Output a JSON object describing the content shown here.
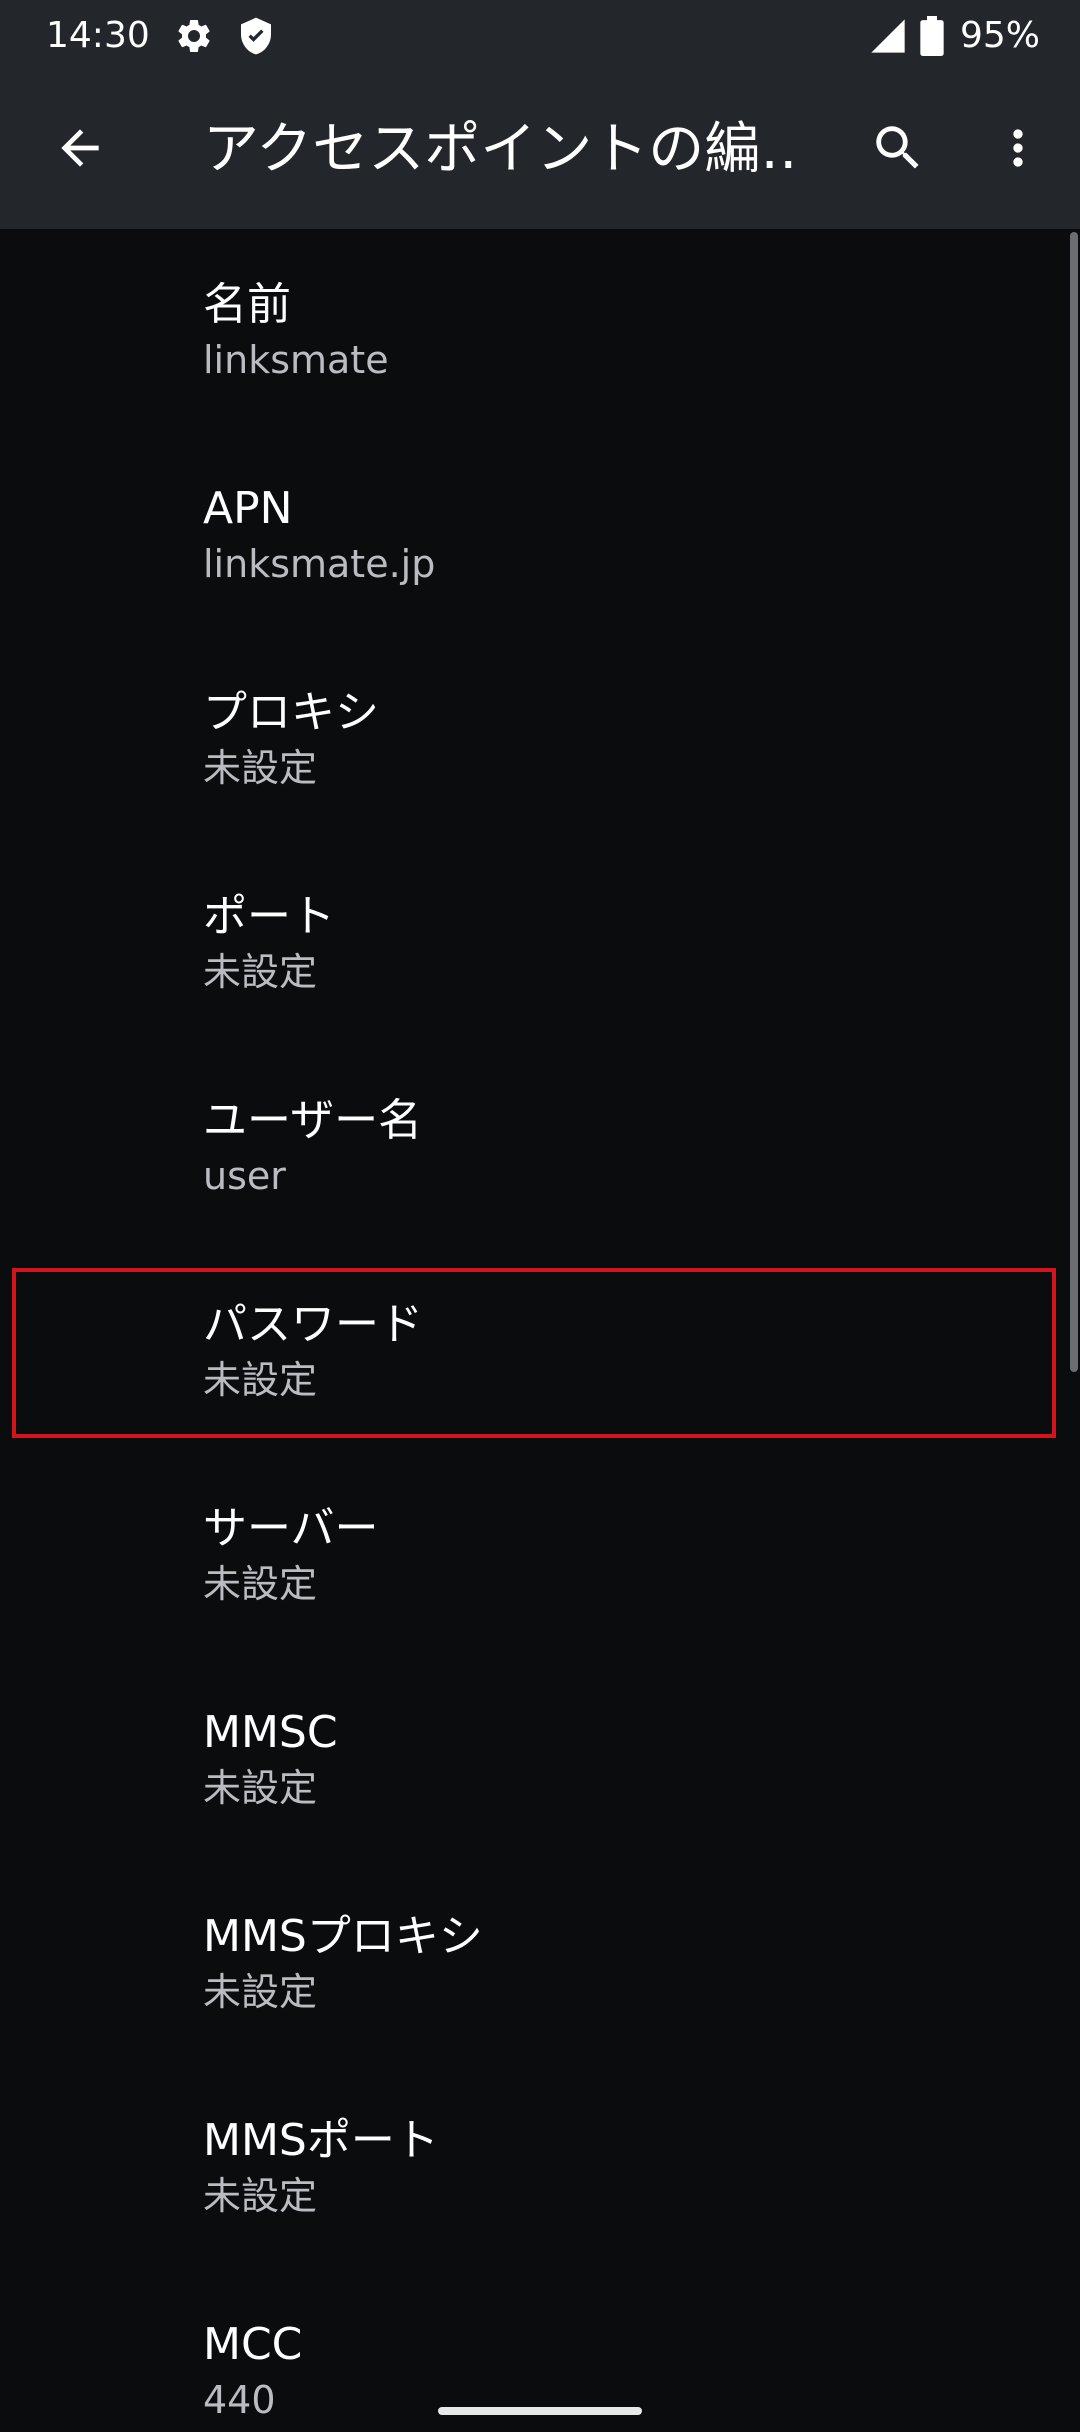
{
  "status_bar": {
    "time": "14:30",
    "battery_percent": "95%",
    "icons": [
      "settings-gear-icon",
      "shield-icon",
      "signal-icon",
      "battery-icon"
    ]
  },
  "app_bar": {
    "title": "アクセスポイントの編…",
    "back_icon": "arrow-back-icon",
    "search_icon": "search-icon",
    "more_icon": "more-vert-icon"
  },
  "preferences": [
    {
      "title": "名前",
      "summary": "linksmate"
    },
    {
      "title": "APN",
      "summary": "linksmate.jp"
    },
    {
      "title": "プロキシ",
      "summary": "未設定"
    },
    {
      "title": "ポート",
      "summary": "未設定"
    },
    {
      "title": "ユーザー名",
      "summary": "user"
    },
    {
      "title": "パスワード",
      "summary": "未設定"
    },
    {
      "title": "サーバー",
      "summary": "未設定"
    },
    {
      "title": "MMSC",
      "summary": "未設定"
    },
    {
      "title": "MMSプロキシ",
      "summary": "未設定"
    },
    {
      "title": "MMSポート",
      "summary": "未設定"
    },
    {
      "title": "MCC",
      "summary": "440"
    }
  ],
  "colors": {
    "bar_background": "#23272c",
    "list_background": "#0b0c0e",
    "highlight_border": "#d4141c",
    "summary_text": "#b9bcc1"
  }
}
